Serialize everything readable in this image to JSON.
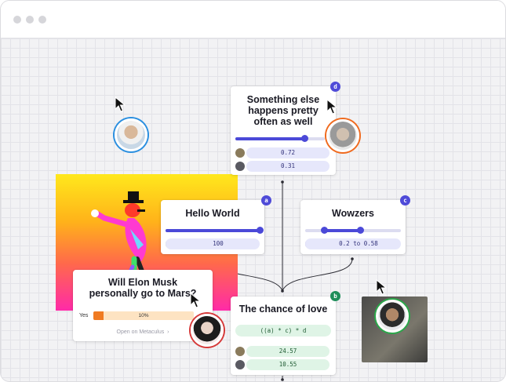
{
  "window": {
    "controls": [
      "window-dot",
      "window-dot",
      "window-dot"
    ]
  },
  "colors": {
    "accent": "#4b49d8",
    "badge_purple": "#4f4bd8",
    "badge_green": "#1e8e5a",
    "orange_ring": "#f06a1e",
    "blue_ring": "#2a8fe0",
    "red_ring": "#d63a3a",
    "green_ring": "#2aa84a"
  },
  "cards": {
    "something": {
      "title": "Something else happens pretty often as well",
      "badge": "d",
      "values": [
        "0.72",
        "0.31"
      ],
      "slider_fraction": 0.72
    },
    "hello": {
      "title": "Hello World",
      "badge": "a",
      "values": [
        "100"
      ],
      "slider_fraction": 1.0
    },
    "wowzers": {
      "title": "Wowzers",
      "badge": "c",
      "values": [
        "0.2 to 0.58"
      ],
      "range": [
        0.2,
        0.58
      ]
    },
    "love": {
      "title": "The chance of love",
      "badge": "b",
      "formula": "((a) * c) * d",
      "values": [
        "24.57",
        "10.55"
      ]
    },
    "elon": {
      "title": "Will Elon Musk personally go to Mars?",
      "yes_label": "Yes",
      "percent_label": "10%",
      "percent": 0.1,
      "link": "Open on Metaculus",
      "link_icon": "chevron-right-icon"
    }
  }
}
